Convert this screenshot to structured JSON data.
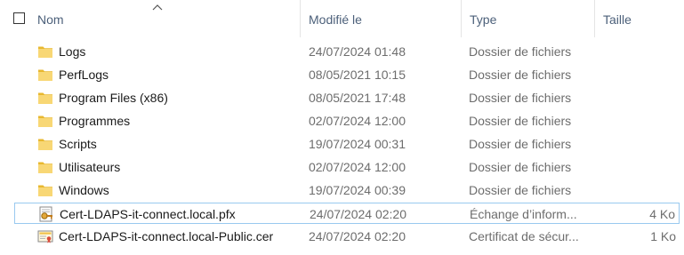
{
  "header": {
    "name": "Nom",
    "modified": "Modifié le",
    "type": "Type",
    "size": "Taille"
  },
  "files": [
    {
      "name": "Logs",
      "modified": "24/07/2024 01:48",
      "type": "Dossier de fichiers",
      "size": "",
      "icon": "folder-icon"
    },
    {
      "name": "PerfLogs",
      "modified": "08/05/2021 10:15",
      "type": "Dossier de fichiers",
      "size": "",
      "icon": "folder-icon"
    },
    {
      "name": "Program Files (x86)",
      "modified": "08/05/2021 17:48",
      "type": "Dossier de fichiers",
      "size": "",
      "icon": "folder-icon"
    },
    {
      "name": "Programmes",
      "modified": "02/07/2024 12:00",
      "type": "Dossier de fichiers",
      "size": "",
      "icon": "folder-icon"
    },
    {
      "name": "Scripts",
      "modified": "19/07/2024 00:31",
      "type": "Dossier de fichiers",
      "size": "",
      "icon": "folder-icon"
    },
    {
      "name": "Utilisateurs",
      "modified": "02/07/2024 12:00",
      "type": "Dossier de fichiers",
      "size": "",
      "icon": "folder-icon"
    },
    {
      "name": "Windows",
      "modified": "19/07/2024 00:39",
      "type": "Dossier de fichiers",
      "size": "",
      "icon": "folder-icon"
    },
    {
      "name": "Cert-LDAPS-it-connect.local.pfx",
      "modified": "24/07/2024 02:20",
      "type": "Échange d’inform...",
      "size": "4 Ko",
      "icon": "pfx-certificate-icon"
    },
    {
      "name": "Cert-LDAPS-it-connect.local-Public.cer",
      "modified": "24/07/2024 02:20",
      "type": "Certificat de sécur...",
      "size": "1 Ko",
      "icon": "certificate-icon"
    }
  ]
}
